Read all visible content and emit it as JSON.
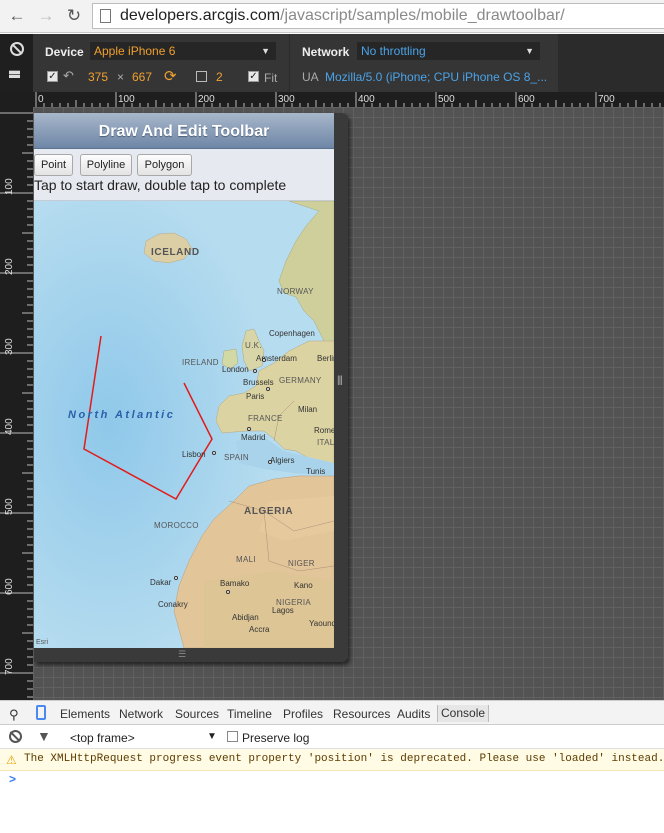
{
  "browser": {
    "url_host": "developers.arcgis.com",
    "url_path": "/javascript/samples/mobile_drawtoolbar/"
  },
  "emulation": {
    "device_label": "Device",
    "device_value": "Apple iPhone 6",
    "width": "375",
    "times": "×",
    "height": "667",
    "scale": "2",
    "fit_label": "Fit",
    "network_label": "Network",
    "network_value": "No throttling",
    "ua_label": "UA",
    "ua_value": "Mozilla/5.0 (iPhone; CPU iPhone OS 8_..."
  },
  "rulers": {
    "top": [
      "0",
      "100",
      "200",
      "300",
      "400",
      "500",
      "600",
      "700"
    ],
    "left": [
      "100",
      "200",
      "300",
      "400",
      "500",
      "600",
      "700"
    ]
  },
  "app": {
    "title": "Draw And Edit Toolbar",
    "buttons": [
      "Point",
      "Polyline",
      "Polygon"
    ],
    "hint": "Tap to start draw, double tap to complete"
  },
  "map": {
    "ocean": "North Atlantic",
    "countries": [
      "ICELAND",
      "NORWAY",
      "U.K.",
      "IRELAND",
      "GERMANY",
      "FRANCE",
      "SPAIN",
      "ITALY",
      "MOROCCO",
      "ALGERIA",
      "MALI",
      "NIGER",
      "NIGERIA"
    ],
    "cities": [
      "Copenhagen",
      "Amsterdam",
      "Berlin",
      "London",
      "Brussels",
      "Paris",
      "Milan",
      "Rome",
      "Madrid",
      "Lisbon",
      "Algiers",
      "Tunis",
      "Dakar",
      "Bamako",
      "Kano",
      "Conakry",
      "Abidjan",
      "Lagos",
      "Accra",
      "Yaoundé"
    ],
    "attribution": "Esri"
  },
  "devtools": {
    "tabs": [
      "Elements",
      "Network",
      "Sources",
      "Timeline",
      "Profiles",
      "Resources",
      "Audits",
      "Console"
    ],
    "frame": "<top frame>",
    "preserve_log": "Preserve log",
    "warning": "The XMLHttpRequest progress event property 'position' is deprecated. Please use 'loaded' instead.",
    "prompt": ">"
  }
}
